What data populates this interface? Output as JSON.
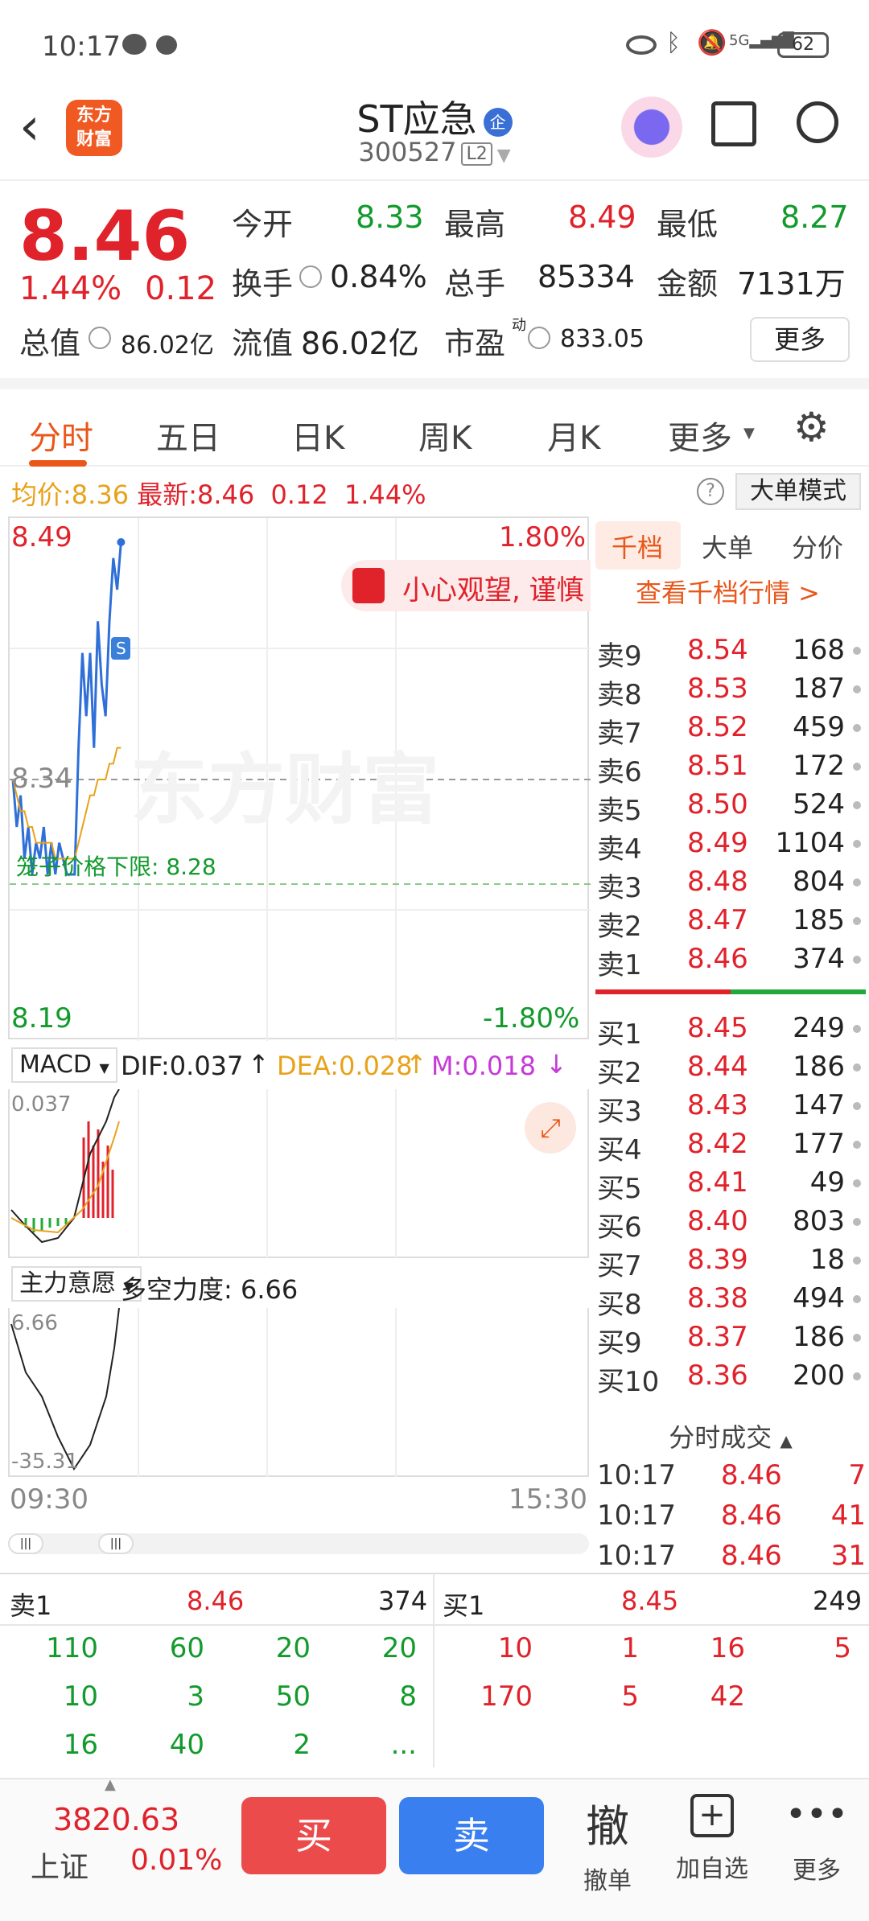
{
  "status": {
    "time": "10:17",
    "battery": "62"
  },
  "header": {
    "title": "ST应急",
    "code": "300527",
    "level": "L2",
    "logo_line1": "东方",
    "logo_line2": "财富",
    "badge": "企"
  },
  "quote": {
    "price": "8.46",
    "change_pct": "1.44%",
    "change": "0.12",
    "open_label": "今开",
    "open": "8.33",
    "high_label": "最高",
    "high": "8.49",
    "low_label": "最低",
    "low": "8.27",
    "turnover_label": "换手",
    "turnover": "0.84%",
    "volume_label": "总手",
    "volume": "85334",
    "amount_label": "金额",
    "amount": "7131万",
    "mcap_label": "总值",
    "mcap": "86.02亿",
    "float_label": "流值",
    "float": "86.02亿",
    "pe_label": "市盈",
    "pe_sup": "动",
    "pe": "833.05",
    "more": "更多"
  },
  "tabs": [
    "分时",
    "五日",
    "日K",
    "周K",
    "月K",
    "更多"
  ],
  "inforow": {
    "avg_label": "均价:",
    "avg": "8.36",
    "latest_label": "最新:",
    "latest": "8.46",
    "chg": "0.12",
    "pct": "1.44%",
    "mode": "大单模式"
  },
  "chart": {
    "high": "8.49",
    "high_pct": "1.80%",
    "low": "8.19",
    "low_pct": "-1.80%",
    "mid": "8.34",
    "limit_text": "笼子价格下限: 8.28",
    "banner": "小心观望, 谨慎",
    "watermark": "东方财富",
    "s_marker": "S",
    "time_start": "09:30",
    "time_end": "15:30"
  },
  "chart_data": {
    "type": "line",
    "title": "",
    "ylim": [
      8.19,
      8.49
    ],
    "series": [
      {
        "values": [
          8.34,
          8.31,
          8.33,
          8.29,
          8.31,
          8.28,
          8.3,
          8.29,
          8.31,
          8.28,
          8.3,
          8.28,
          8.3,
          8.29,
          8.28,
          8.28,
          8.28,
          8.36,
          8.42,
          8.38,
          8.42,
          8.36,
          8.44,
          8.4,
          8.38,
          8.44,
          8.48,
          8.46,
          8.49
        ]
      },
      {
        "values": [
          8.34,
          8.33,
          8.32,
          8.32,
          8.31,
          8.31,
          8.3,
          8.3,
          8.3,
          8.3,
          8.3,
          8.29,
          8.29,
          8.29,
          8.29,
          8.29,
          8.29,
          8.3,
          8.31,
          8.32,
          8.33,
          8.33,
          8.34,
          8.34,
          8.34,
          8.35,
          8.35,
          8.36,
          8.36
        ]
      }
    ]
  },
  "orderbook": {
    "tabs": [
      "千档",
      "大单",
      "分价"
    ],
    "link": "查看千档行情 >",
    "asks": [
      {
        "label": "卖9",
        "price": "8.54",
        "vol": "168"
      },
      {
        "label": "卖8",
        "price": "8.53",
        "vol": "187"
      },
      {
        "label": "卖7",
        "price": "8.52",
        "vol": "459"
      },
      {
        "label": "卖6",
        "price": "8.51",
        "vol": "172"
      },
      {
        "label": "卖5",
        "price": "8.50",
        "vol": "524"
      },
      {
        "label": "卖4",
        "price": "8.49",
        "vol": "1104"
      },
      {
        "label": "卖3",
        "price": "8.48",
        "vol": "804"
      },
      {
        "label": "卖2",
        "price": "8.47",
        "vol": "185"
      },
      {
        "label": "卖1",
        "price": "8.46",
        "vol": "374"
      }
    ],
    "bids": [
      {
        "label": "买1",
        "price": "8.45",
        "vol": "249"
      },
      {
        "label": "买2",
        "price": "8.44",
        "vol": "186"
      },
      {
        "label": "买3",
        "price": "8.43",
        "vol": "147"
      },
      {
        "label": "买4",
        "price": "8.42",
        "vol": "177"
      },
      {
        "label": "买5",
        "price": "8.41",
        "vol": "49"
      },
      {
        "label": "买6",
        "price": "8.40",
        "vol": "803"
      },
      {
        "label": "买7",
        "price": "8.39",
        "vol": "18"
      },
      {
        "label": "买8",
        "price": "8.38",
        "vol": "494"
      },
      {
        "label": "买9",
        "price": "8.37",
        "vol": "186"
      },
      {
        "label": "买10",
        "price": "8.36",
        "vol": "200"
      }
    ],
    "trades_title": "分时成交",
    "trades": [
      {
        "time": "10:17",
        "price": "8.46",
        "vol": "7"
      },
      {
        "time": "10:17",
        "price": "8.46",
        "vol": "41"
      },
      {
        "time": "10:17",
        "price": "8.46",
        "vol": "31"
      }
    ]
  },
  "macd": {
    "label": "MACD",
    "dif": "DIF:0.037",
    "dea": "DEA:0.028",
    "m": "M:0.018",
    "top": "0.037"
  },
  "mainforce": {
    "label": "主力意愿",
    "value": "多空力度: 6.66",
    "top": "6.66",
    "bottom": "-35.31"
  },
  "depth": {
    "ask_label": "卖1",
    "ask_price": "8.46",
    "ask_vol": "374",
    "bid_label": "买1",
    "bid_price": "8.45",
    "bid_vol": "249",
    "left_rows": [
      [
        "110",
        "60",
        "20",
        "20"
      ],
      [
        "10",
        "3",
        "50",
        "8"
      ],
      [
        "16",
        "40",
        "2",
        "..."
      ]
    ],
    "right_rows": [
      [
        "10",
        "1",
        "16",
        "5"
      ],
      [
        "170",
        "5",
        "42",
        ""
      ]
    ]
  },
  "bottom": {
    "index_value": "3820.63",
    "index_name": "上证",
    "index_pct": "0.01%",
    "buy": "买",
    "sell": "卖",
    "cancel_glyph": "撤",
    "cancel": "撤单",
    "add": "加自选",
    "more": "更多"
  }
}
